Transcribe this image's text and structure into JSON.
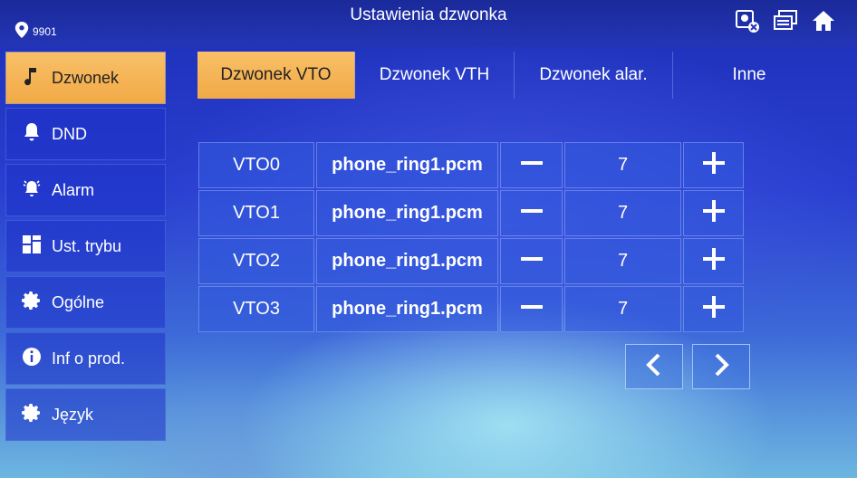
{
  "header": {
    "title": "Ustawienia dzwonka",
    "room_number": "9901",
    "icons": [
      "location-pin-icon",
      "camera-disconnected-icon",
      "monitor-windows-icon",
      "home-icon"
    ]
  },
  "sidebar": {
    "items": [
      {
        "label": "Dzwonek",
        "icon": "music-note-icon",
        "active": true
      },
      {
        "label": "DND",
        "icon": "bell-icon"
      },
      {
        "label": "Alarm",
        "icon": "alarm-bell-icon"
      },
      {
        "label": "Ust. trybu",
        "icon": "layout-grid-icon"
      },
      {
        "label": "Ogólne",
        "icon": "gear-icon"
      },
      {
        "label": "Inf o prod.",
        "icon": "info-icon"
      },
      {
        "label": "Język",
        "icon": "gear-icon"
      }
    ]
  },
  "tabs": [
    {
      "label": "Dzwonek VTO",
      "active": true
    },
    {
      "label": "Dzwonek VTH"
    },
    {
      "label": "Dzwonek alar."
    },
    {
      "label": "Inne"
    }
  ],
  "ring_rows": [
    {
      "device": "VTO0",
      "file": "phone_ring1.pcm",
      "volume": "7"
    },
    {
      "device": "VTO1",
      "file": "phone_ring1.pcm",
      "volume": "7"
    },
    {
      "device": "VTO2",
      "file": "phone_ring1.pcm",
      "volume": "7"
    },
    {
      "device": "VTO3",
      "file": "phone_ring1.pcm",
      "volume": "7"
    }
  ],
  "pager": {
    "prev_icon": "chevron-left-icon",
    "next_icon": "chevron-right-icon"
  },
  "colors": {
    "accent": "#f1a946",
    "background": "#2a3fd0"
  }
}
